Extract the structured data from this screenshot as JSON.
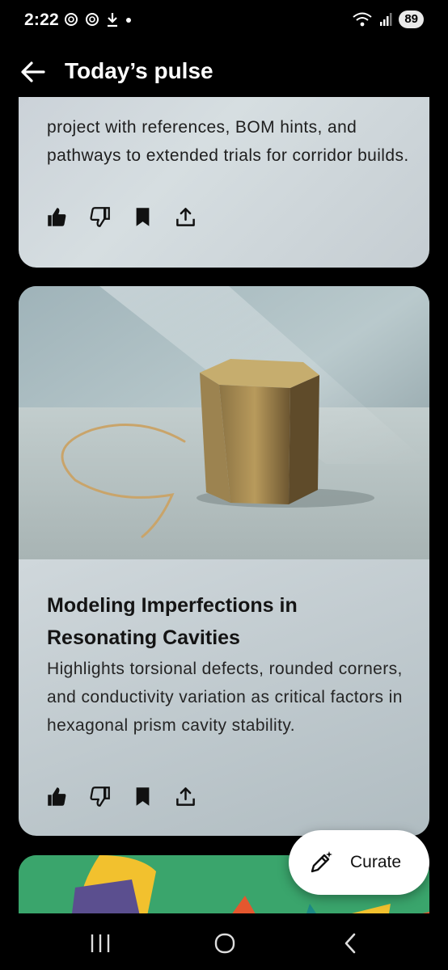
{
  "status_bar": {
    "time": "2:22",
    "battery": "89"
  },
  "app_bar": {
    "title": "Today’s pulse",
    "back_icon": "arrow-left-icon"
  },
  "cards": [
    {
      "summary": "project with references, BOM hints, and pathways to extended trials for corridor builds.",
      "actions": [
        "thumb-up-icon",
        "thumb-down-icon",
        "bookmark-icon",
        "share-icon"
      ]
    },
    {
      "headline": "Modeling Imperfections in Resonating Cavities",
      "summary": "Highlights torsional defects, rounded corners, and conductivity variation as critical factors in hexagonal prism cavity stability.",
      "actions": [
        "thumb-up-icon",
        "thumb-down-icon",
        "bookmark-icon",
        "share-icon"
      ]
    }
  ],
  "fab": {
    "label": "Curate",
    "icon": "pen-sparkle-icon"
  },
  "nav_bar": {
    "buttons": [
      "recents-icon",
      "home-icon",
      "back-icon"
    ]
  },
  "colors": {
    "background": "#000000",
    "card_light": "#d6dee1",
    "card_image_bg": "#b7c3c7",
    "accent_green": "#3aa56c"
  }
}
